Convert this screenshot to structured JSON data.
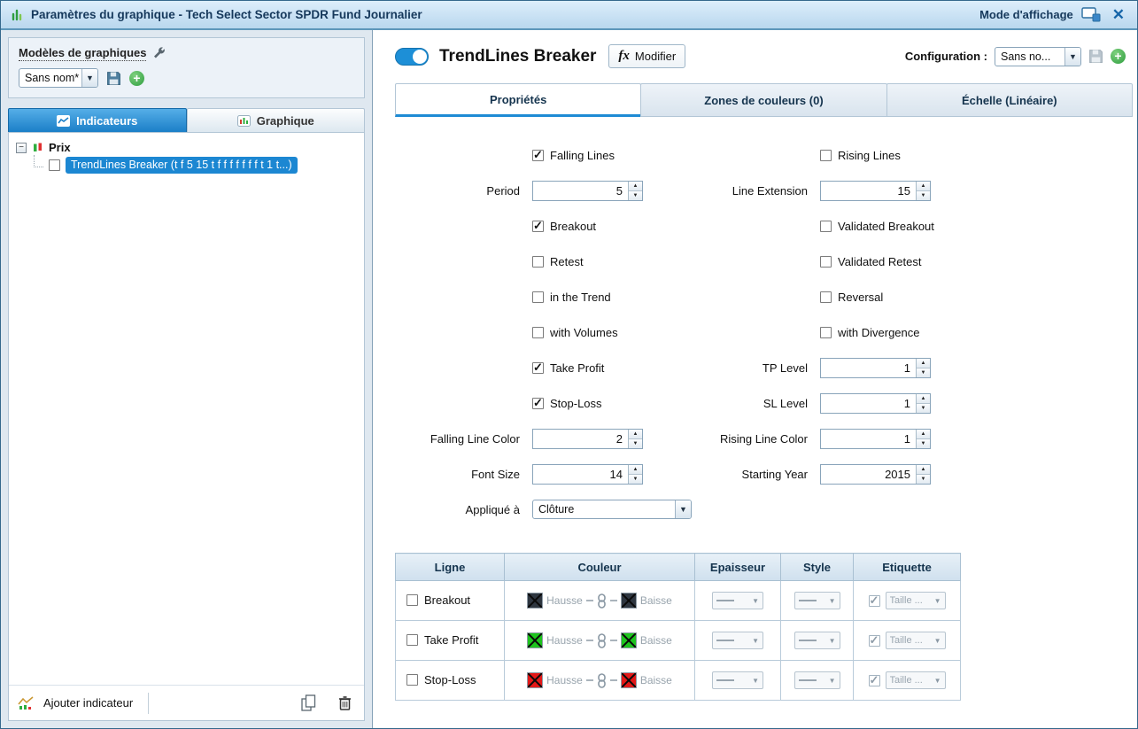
{
  "titlebar": {
    "title": "Paramètres du graphique - Tech Select Sector SPDR Fund Journalier",
    "display_mode_label": "Mode d'affichage",
    "close_icon": "✕"
  },
  "left_panel": {
    "templates_label": "Modèles de graphiques",
    "template_select_value": "Sans nom*",
    "tab_indicators": "Indicateurs",
    "tab_chart": "Graphique",
    "tree_root_label": "Prix",
    "tree_child_label": "TrendLines Breaker (t f 5 15 t f f f f f f f t 1 t...)",
    "add_indicator_label": "Ajouter indicateur"
  },
  "header": {
    "indicator_title": "TrendLines Breaker",
    "fx_glyph": "fx",
    "modify_label": "Modifier",
    "configuration_label": "Configuration :",
    "configuration_value": "Sans no..."
  },
  "tabs": {
    "properties": "Propriétés",
    "color_zones": "Zones de couleurs (0)",
    "scale": "Échelle (Linéaire)"
  },
  "form": {
    "falling_lines": {
      "label": "Falling Lines",
      "checked": "checked"
    },
    "rising_lines": {
      "label": "Rising Lines"
    },
    "period": {
      "label": "Period",
      "value": "5"
    },
    "line_extension": {
      "label": "Line Extension",
      "value": "15"
    },
    "breakout": {
      "label": "Breakout",
      "checked": "checked"
    },
    "validated_breakout": {
      "label": "Validated Breakout"
    },
    "retest": {
      "label": "Retest"
    },
    "validated_retest": {
      "label": "Validated Retest"
    },
    "in_the_trend": {
      "label": "in the Trend"
    },
    "reversal": {
      "label": "Reversal"
    },
    "with_volumes": {
      "label": "with Volumes"
    },
    "with_divergence": {
      "label": "with Divergence"
    },
    "take_profit": {
      "label": "Take Profit",
      "checked": "checked"
    },
    "tp_level": {
      "label": "TP Level",
      "value": "1"
    },
    "stop_loss": {
      "label": "Stop-Loss",
      "checked": "checked"
    },
    "sl_level": {
      "label": "SL Level",
      "value": "1"
    },
    "falling_line_color": {
      "label": "Falling Line Color",
      "value": "2"
    },
    "rising_line_color": {
      "label": "Rising Line Color",
      "value": "1"
    },
    "font_size": {
      "label": "Font Size",
      "value": "14"
    },
    "starting_year": {
      "label": "Starting Year",
      "value": "2015"
    },
    "applied_to": {
      "label": "Appliqué à",
      "value": "Clôture"
    }
  },
  "lines_table": {
    "headers": [
      "Ligne",
      "Couleur",
      "Epaisseur",
      "Style",
      "Etiquette"
    ],
    "up_label": "Hausse",
    "down_label": "Baisse",
    "size_label": "Taille ...",
    "etiquette_checked": "checked",
    "rows": [
      {
        "label": "Breakout",
        "color": "#2e3640"
      },
      {
        "label": "Take Profit",
        "color": "#1ec41e"
      },
      {
        "label": "Stop-Loss",
        "color": "#e31818"
      }
    ]
  },
  "colors": {
    "accent_blue": "#1e8bd4",
    "selection_blue": "#1c87d2",
    "plus_green": "#2f9e3f"
  }
}
